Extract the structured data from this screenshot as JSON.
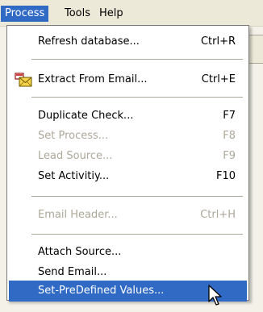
{
  "menubar": {
    "items": [
      {
        "label": "Process"
      },
      {
        "label": "Tools"
      },
      {
        "label": "Help"
      }
    ]
  },
  "menu": {
    "items": [
      {
        "label": "Refresh database...",
        "shortcut": "Ctrl+R",
        "enabled": true
      },
      {
        "label": "Extract From Email...",
        "shortcut": "Ctrl+E",
        "enabled": true,
        "icon": "email-icon"
      },
      {
        "label": "Duplicate Check...",
        "shortcut": "F7",
        "enabled": true
      },
      {
        "label": "Set Process...",
        "shortcut": "F8",
        "enabled": false
      },
      {
        "label": "Lead Source...",
        "shortcut": "F9",
        "enabled": false
      },
      {
        "label": "Set Activitiy...",
        "shortcut": "F10",
        "enabled": true
      },
      {
        "label": "Email Header...",
        "shortcut": "Ctrl+H",
        "enabled": false
      },
      {
        "label": "Attach Source...",
        "enabled": true
      },
      {
        "label": "Send Email...",
        "enabled": true
      },
      {
        "label": "Set-PreDefined Values...",
        "enabled": true,
        "highlighted": true
      }
    ]
  },
  "colors": {
    "highlight": "#316ac5",
    "disabled_text": "#aca899",
    "menubar_bg": "#ece9d8"
  }
}
